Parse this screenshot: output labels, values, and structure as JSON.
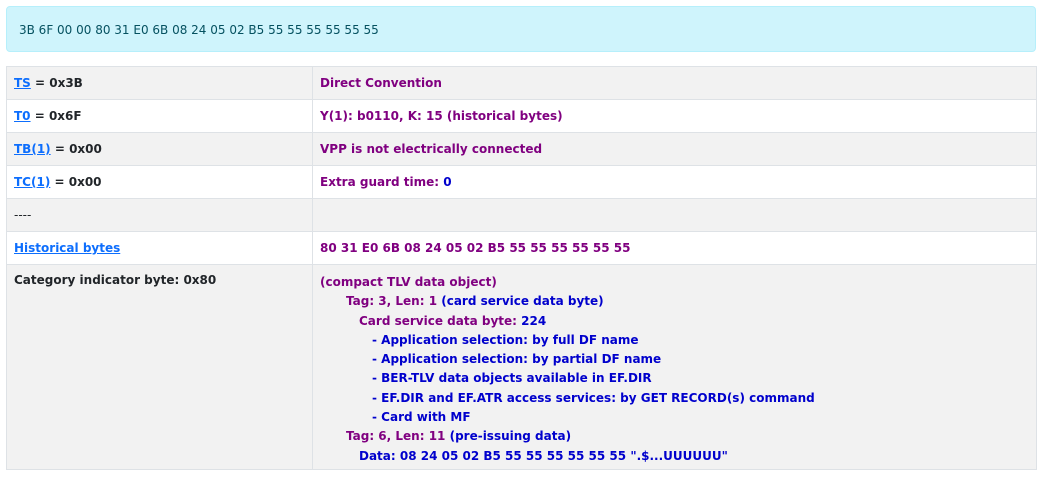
{
  "atr": "3B 6F 00 00 80 31 E0 6B 08 24 05 02 B5 55 55 55 55 55 55",
  "rows": {
    "ts": {
      "link": "TS",
      "value": " = 0x3B",
      "desc": "Direct Convention"
    },
    "t0": {
      "link": "T0",
      "value": " = 0x6F",
      "desc_a": "Y(1): b0110, K: 15 ",
      "desc_b": "(historical bytes)"
    },
    "tb1": {
      "link": "TB(1)",
      "value": " = 0x00",
      "desc": "VPP is not electrically connected"
    },
    "tc1": {
      "link": "TC(1)",
      "value": " = 0x00",
      "desc_a": "Extra guard time: ",
      "desc_b": "0"
    },
    "sep": {
      "label": "----"
    },
    "hist": {
      "link": "Historical bytes",
      "desc": "80 31 E0 6B 08 24 05 02 B5 55 55 55 55 55 55"
    },
    "cat": {
      "label": "Category indicator byte: 0x80",
      "l1": "(compact TLV data object)",
      "l2_a": "Tag: 3, Len: 1 ",
      "l2_b": "(card service data byte)",
      "l3_a": "Card service data byte: ",
      "l3_b": "224",
      "items": [
        "- Application selection: by full DF name",
        "- Application selection: by partial DF name",
        "- BER-TLV data objects available in EF.DIR",
        "- EF.DIR and EF.ATR access services: by GET RECORD(s) command",
        "- Card with MF"
      ],
      "l4_a": "Tag: 6, Len: 11 ",
      "l4_b": "(pre-issuing data)",
      "l5": "Data: 08 24 05 02 B5 55 55 55 55 55 55 \".$...UUUUUU\""
    }
  }
}
